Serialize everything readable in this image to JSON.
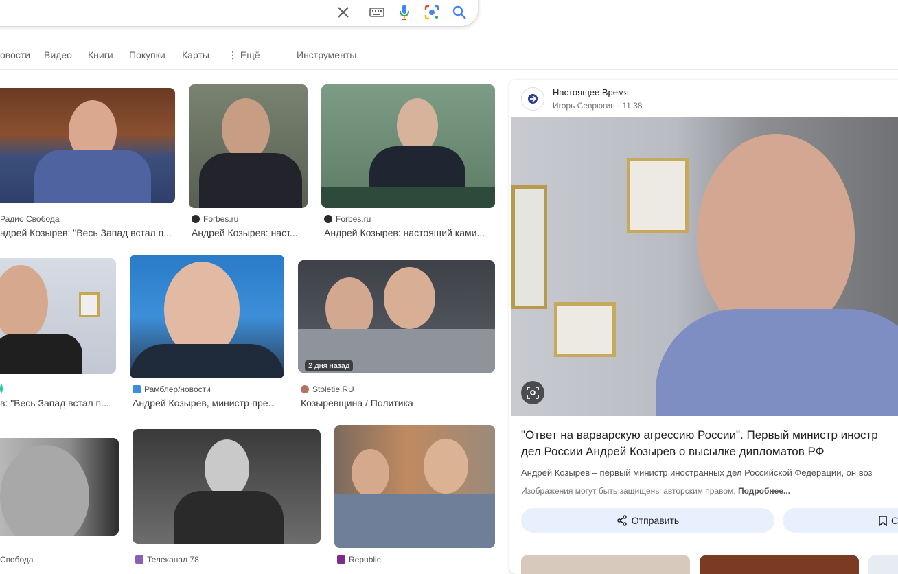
{
  "tabs": {
    "news": "овости",
    "video": "Видео",
    "books": "Книги",
    "shopping": "Покупки",
    "maps": "Карты",
    "more": "⋮ Ещё",
    "tools": "Инструменты"
  },
  "results": [
    {
      "source": "Радио Свобода",
      "title": "ндрей Козырев: \"Весь Запад встал п..."
    },
    {
      "source": "Forbes.ru",
      "title": "Андрей Козырев: наст..."
    },
    {
      "source": "Forbes.ru",
      "title": "Андрей Козырев: настоящий ками..."
    },
    {
      "source": "",
      "title": "в: \"Весь Запад встал п..."
    },
    {
      "source": "Рамблер/новости",
      "title": "Андрей Козырев, министр-пре..."
    },
    {
      "source": "Stoletie.RU",
      "title": "Козыревщина / Политика",
      "badge": "2 дня назад"
    },
    {
      "source": "Свобода",
      "title": ""
    },
    {
      "source": "Телеканал 78",
      "title": ""
    },
    {
      "source": "Republic",
      "title": ""
    }
  ],
  "panel": {
    "source_name": "Настоящее Время",
    "meta": "Игорь Севрюгин · 11:38",
    "headline_line1": "\"Ответ на варварскую агрессию России\". Первый министр иностр",
    "headline_line2": "дел России Андрей Козырев о высылке дипломатов РФ",
    "snippet": "Андрей Козырев – первый министр иностранных дел Российской Федерации, он воз",
    "copyright": "Изображения могут быть защищены авторским правом.",
    "more_link": "Подробнее...",
    "share_label": "Отправить",
    "save_label": "С"
  },
  "colors": {
    "accent": "#1a73e8",
    "tab_text": "#5f6368",
    "button_bg": "#e8f0fe"
  },
  "icons": [
    "close-icon",
    "keyboard-icon",
    "mic-icon",
    "lens-icon",
    "search-icon",
    "share-icon",
    "bookmark-icon",
    "lens-search-icon"
  ]
}
